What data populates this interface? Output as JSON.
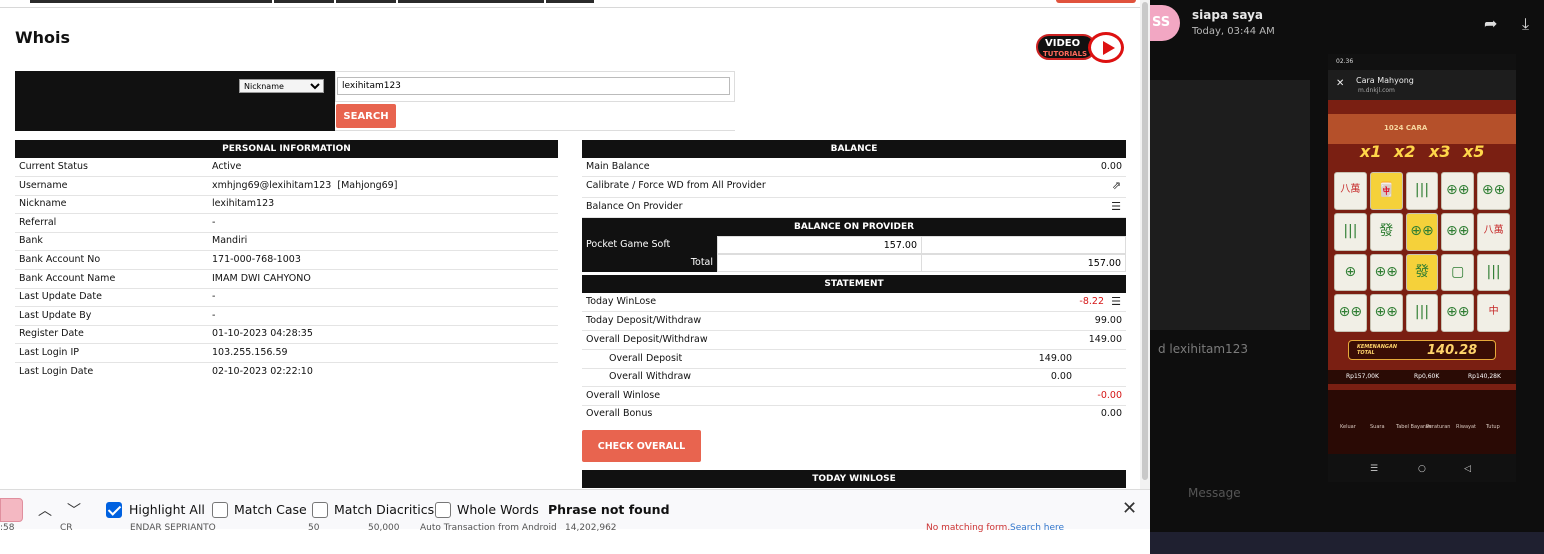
{
  "whois": {
    "title": "Whois",
    "video_badge": {
      "line1": "VIDEO",
      "line2": "TUTORIALS"
    },
    "search": {
      "select_value": "Nickname",
      "input_value": "lexihitam123",
      "button_label": "SEARCH"
    },
    "personal": {
      "header": "PERSONAL INFORMATION",
      "rows": [
        {
          "label": "Current Status",
          "value": "Active"
        },
        {
          "label": "Username",
          "value": "xmhjng69@lexihitam123  [Mahjong69]"
        },
        {
          "label": "Nickname",
          "value": "lexihitam123"
        },
        {
          "label": "Referral",
          "value": "-"
        },
        {
          "label": "Bank",
          "value": "Mandiri"
        },
        {
          "label": "Bank Account No",
          "value": "171-000-768-1003"
        },
        {
          "label": "Bank Account Name",
          "value": "IMAM DWI CAHYONO"
        },
        {
          "label": "Last Update Date",
          "value": "-"
        },
        {
          "label": "Last Update By",
          "value": "-"
        },
        {
          "label": "Register Date",
          "value": "01-10-2023 04:28:35"
        },
        {
          "label": "Last Login IP",
          "value": "103.255.156.59"
        },
        {
          "label": "Last Login Date",
          "value": "02-10-2023 02:22:10"
        }
      ]
    },
    "balance": {
      "header": "BALANCE",
      "main_label": "Main Balance",
      "main_value": "0.00",
      "calibrate_label": "Calibrate / Force WD from All Provider",
      "on_provider_label": "Balance On Provider",
      "provider_header": "BALANCE ON PROVIDER",
      "provider_name": "Pocket Game Soft",
      "provider_value": "157.00",
      "total_label": "Total",
      "total_value": "157.00"
    },
    "statement": {
      "header": "STATEMENT",
      "today_winlose_label": "Today WinLose",
      "today_winlose_value": "-8.22",
      "today_dw_label": "Today Deposit/Withdraw",
      "today_dw_value": "99.00",
      "overall_dw_label": "Overall Deposit/Withdraw",
      "overall_dw_value": "149.00",
      "overall_deposit_label": "Overall Deposit",
      "overall_deposit_value": "149.00",
      "overall_withdraw_label": "Overall Withdraw",
      "overall_withdraw_value": "0.00",
      "overall_winlose_label": "Overall Winlose",
      "overall_winlose_value": "-0.00",
      "overall_bonus_label": "Overall Bonus",
      "overall_bonus_value": "0.00",
      "check_button": "CHECK OVERALL",
      "today_winlose_header": "TODAY WINLOSE"
    }
  },
  "findbar": {
    "highlight_all": "Highlight All",
    "match_case": "Match Case",
    "match_diacritics": "Match Diacritics",
    "whole_words": "Whole Words",
    "status": "Phrase not found",
    "highlight_checked": true
  },
  "underlay": {
    "time": ":58",
    "code": "CR",
    "name": "ENDAR SEPRIANTO",
    "num1": "50",
    "num2": "50,000",
    "desc": "Auto Transaction from Android",
    "num3": "14,202,962",
    "no_match": "No matching form.",
    "search_here": "Search here"
  },
  "chat": {
    "avatar_initials": "SS",
    "sender": "siapa saya",
    "time": "Today, 03:44 AM",
    "caption": "d lexihitam123",
    "message_placeholder": "Message"
  },
  "phone": {
    "status_time": "02.36",
    "page_title": "Cara Mahyong",
    "page_url": "m.dnkjl.com",
    "banner": "1024 CARA",
    "multipliers": [
      "x1",
      "x2",
      "x3",
      "x5"
    ],
    "win_label": "KEMENANGAN TOTAL",
    "win_value": "140.28",
    "stat1": "Rp157,00K",
    "stat2": "Rp0,60K",
    "stat3": "Rp140,28K",
    "controls": [
      "Keluar",
      "Suara",
      "Tabel Bayaran",
      "Peraturan",
      "Riwayat",
      "Tutup"
    ],
    "tiles": [
      "八萬",
      "🀄",
      "|||",
      "⊕⊕",
      "⊕⊕",
      "|||",
      "發",
      "⊕⊕",
      "⊕⊕",
      "八萬",
      "⊕",
      "⊕⊕",
      "發",
      "▢",
      "|||",
      "⊕⊕",
      "⊕⊕",
      "|||",
      "⊕⊕",
      "中"
    ]
  }
}
